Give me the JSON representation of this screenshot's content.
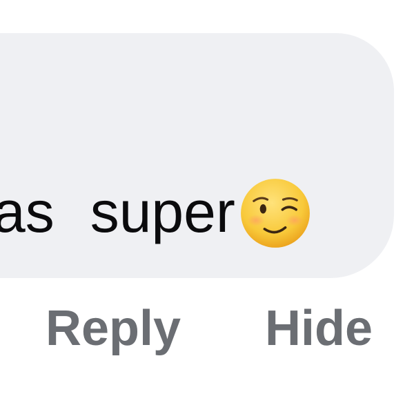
{
  "message": {
    "text_fragment": "as",
    "text_word": "super",
    "emoji": "winking-face-icon"
  },
  "actions": {
    "reply_label": "Reply",
    "hide_label": "Hide"
  },
  "colors": {
    "bubble_bg": "#eff0f3",
    "text": "#0b0b0d",
    "action_text": "#6b6e73"
  }
}
